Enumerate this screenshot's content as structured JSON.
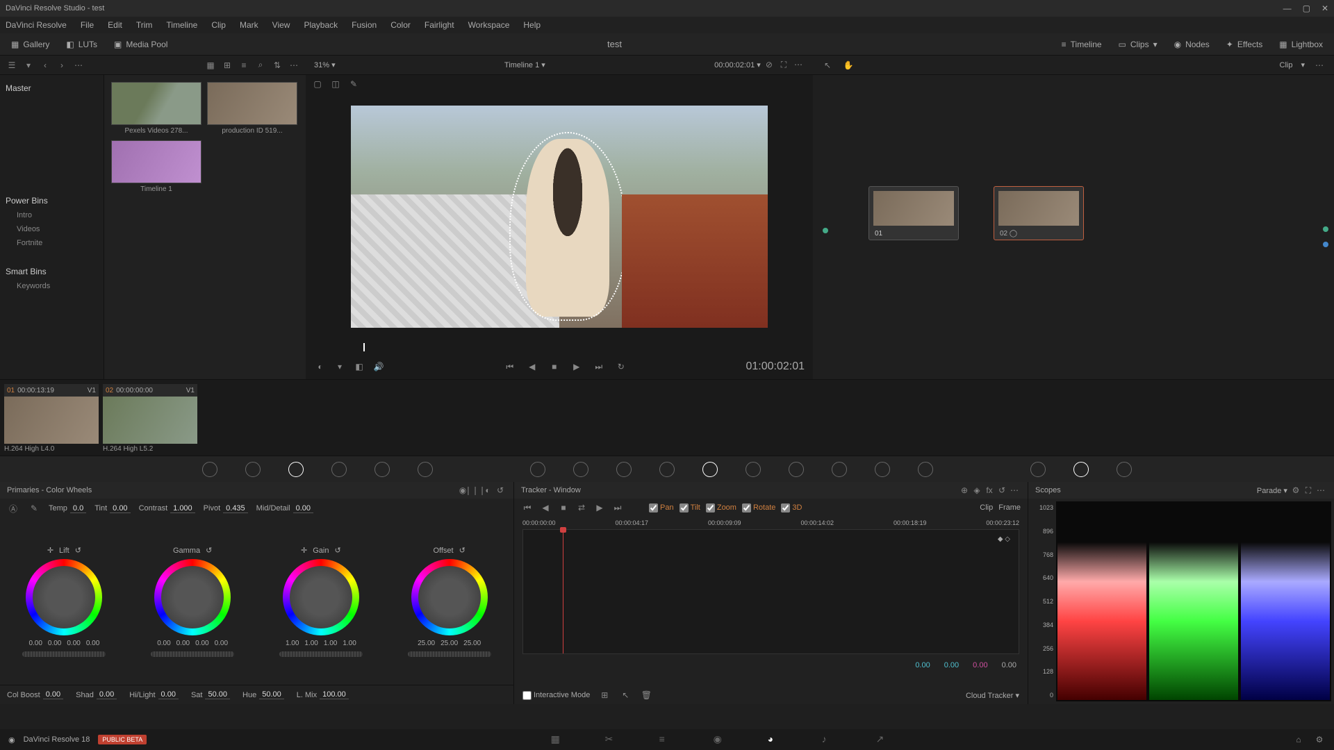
{
  "window": {
    "title": "DaVinci Resolve Studio - test"
  },
  "menu": [
    "DaVinci Resolve",
    "File",
    "Edit",
    "Trim",
    "Timeline",
    "Clip",
    "Mark",
    "View",
    "Playback",
    "Fusion",
    "Color",
    "Fairlight",
    "Workspace",
    "Help"
  ],
  "toolbar": {
    "gallery": "Gallery",
    "luts": "LUTs",
    "mediapool": "Media Pool",
    "project": "test",
    "timeline": "Timeline",
    "clips": "Clips",
    "nodes": "Nodes",
    "effects": "Effects",
    "lightbox": "Lightbox"
  },
  "row2": {
    "zoom": "31%",
    "timeline": "Timeline 1",
    "tc": "00:00:02:01",
    "mode": "Clip"
  },
  "sidebar": {
    "master": "Master",
    "powerbins": "Power Bins",
    "intro": "Intro",
    "videos": "Videos",
    "fortnite": "Fortnite",
    "smartbins": "Smart Bins",
    "keywords": "Keywords"
  },
  "media": {
    "c1": "Pexels Videos 278...",
    "c2": "production ID 519...",
    "c3": "Timeline 1"
  },
  "viewer": {
    "tc": "01:00:02:01"
  },
  "nodes": {
    "n1": "01",
    "n2": "02"
  },
  "clips": {
    "c1_num": "01",
    "c1_tc": "00:00:13:19",
    "c1_v": "V1",
    "c1_name": "H.264 High L4.0",
    "c2_num": "02",
    "c2_tc": "00:00:00:00",
    "c2_v": "V1",
    "c2_name": "H.264 High L5.2"
  },
  "primaries": {
    "title": "Primaries - Color Wheels",
    "temp": {
      "l": "Temp",
      "v": "0.0"
    },
    "tint": {
      "l": "Tint",
      "v": "0.00"
    },
    "contrast": {
      "l": "Contrast",
      "v": "1.000"
    },
    "pivot": {
      "l": "Pivot",
      "v": "0.435"
    },
    "md": {
      "l": "Mid/Detail",
      "v": "0.00"
    },
    "lift": {
      "l": "Lift",
      "v1": "0.00",
      "v2": "0.00",
      "v3": "0.00",
      "v4": "0.00"
    },
    "gamma": {
      "l": "Gamma",
      "v1": "0.00",
      "v2": "0.00",
      "v3": "0.00",
      "v4": "0.00"
    },
    "gain": {
      "l": "Gain",
      "v1": "1.00",
      "v2": "1.00",
      "v3": "1.00",
      "v4": "1.00"
    },
    "offset": {
      "l": "Offset",
      "v1": "25.00",
      "v2": "25.00",
      "v3": "25.00"
    },
    "colboost": {
      "l": "Col Boost",
      "v": "0.00"
    },
    "shad": {
      "l": "Shad",
      "v": "0.00"
    },
    "hl": {
      "l": "Hi/Light",
      "v": "0.00"
    },
    "sat": {
      "l": "Sat",
      "v": "50.00"
    },
    "hue": {
      "l": "Hue",
      "v": "50.00"
    },
    "lmix": {
      "l": "L. Mix",
      "v": "100.00"
    }
  },
  "tracker": {
    "title": "Tracker - Window",
    "pan": "Pan",
    "tilt": "Tilt",
    "zoom": "Zoom",
    "rotate": "Rotate",
    "threed": "3D",
    "clip": "Clip",
    "frame": "Frame",
    "t0": "00:00:00:00",
    "t1": "00:00:04:17",
    "t2": "00:00:09:09",
    "t3": "00:00:14:02",
    "t4": "00:00:18:19",
    "t5": "00:00:23:12",
    "v1": "0.00",
    "v2": "0.00",
    "v3": "0.00",
    "v4": "0.00",
    "interactive": "Interactive Mode",
    "cloud": "Cloud Tracker"
  },
  "scopes": {
    "title": "Scopes",
    "mode": "Parade",
    "y0": "1023",
    "y1": "896",
    "y2": "768",
    "y3": "640",
    "y4": "512",
    "y5": "384",
    "y6": "256",
    "y7": "128",
    "y8": "0"
  },
  "footer": {
    "app": "DaVinci Resolve 18",
    "beta": "PUBLIC BETA"
  }
}
